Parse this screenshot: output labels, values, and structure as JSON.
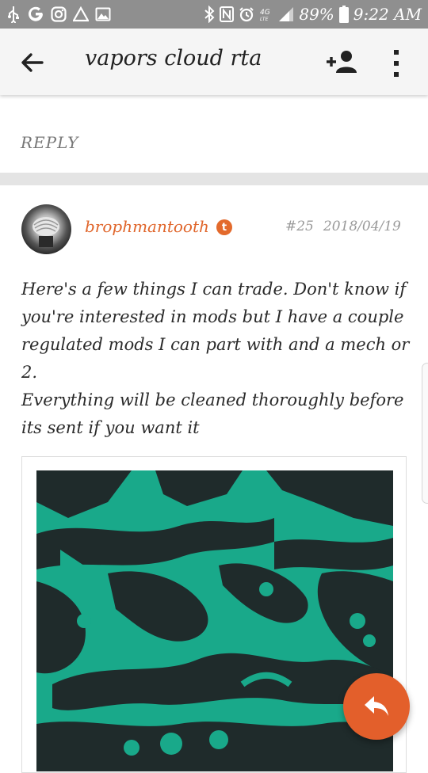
{
  "status_bar": {
    "battery": "89%",
    "time": "9:22 AM",
    "left_icons": [
      "usb-icon",
      "google-icon",
      "instagram-icon",
      "alert-icon",
      "gallery-icon"
    ],
    "right_icons": [
      "bluetooth-icon",
      "nfc-icon",
      "alarm-icon",
      "lte-icon",
      "signal-icon",
      "battery-icon"
    ]
  },
  "app_bar": {
    "title": "vapors cloud rta",
    "icons": [
      "arrow-back-icon",
      "add-user-icon",
      "more-vert-icon"
    ]
  },
  "reply": {
    "label": "REPLY"
  },
  "post": {
    "username": "brophmantooth",
    "badge": "t",
    "number": "#25",
    "date": "2018/04/19",
    "body": [
      "Here's a few things I can trade. Don't know if you're interested in mods but I have a couple regulated mods I can part with and a mech or 2.",
      "Everything will be cleaned thoroughly before its sent if you want it"
    ]
  },
  "fab": {
    "icon": "reply-icon"
  },
  "colors": {
    "status_bar": "#8f8f8f",
    "app_bar": "#f5f5f5",
    "accent": "#e35f2b",
    "username": "#e0652a",
    "image_green": "#19a98a",
    "image_dark": "#1f2b2b"
  }
}
